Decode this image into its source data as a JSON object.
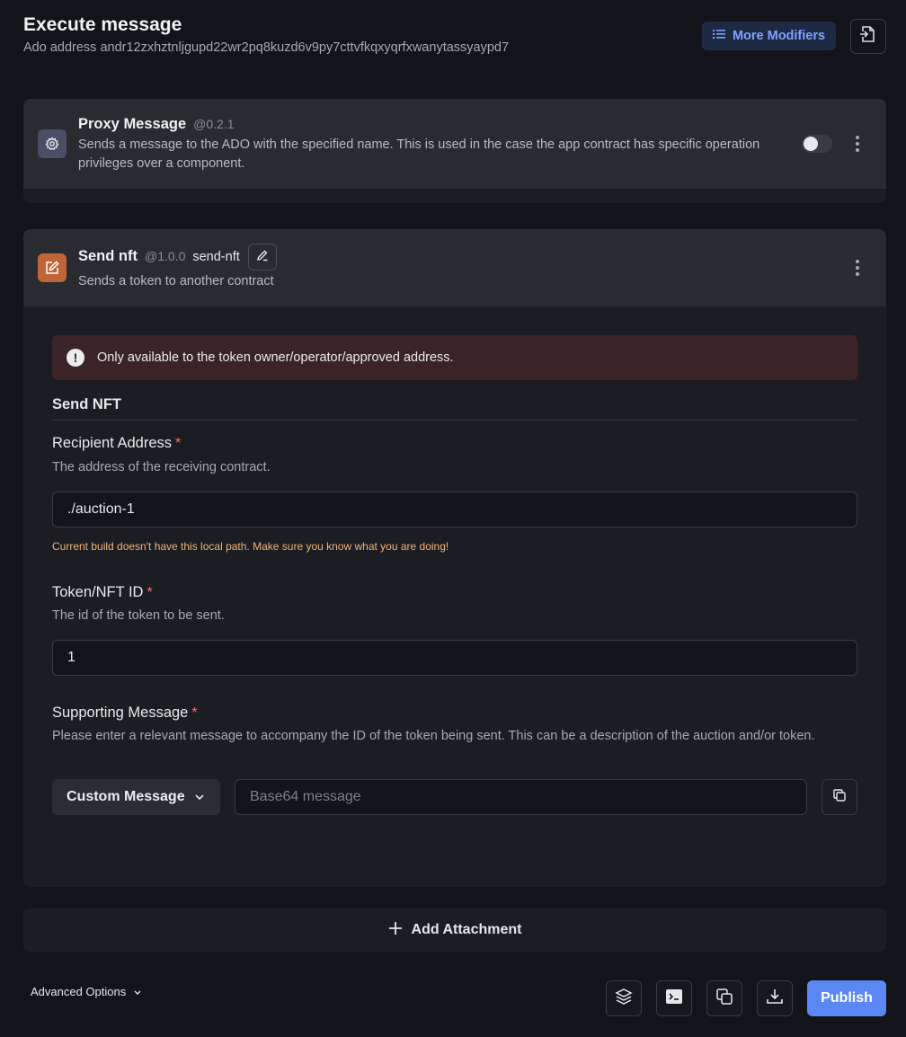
{
  "header": {
    "title": "Execute message",
    "ado_line": "Ado address andr12zxhztnljgupd22wr2pq8kuzd6v9py7cttvfkqxyqrfxwanytassyaypd7",
    "more_modifiers_label": "More Modifiers"
  },
  "proxy_card": {
    "title": "Proxy Message",
    "version": "@0.2.1",
    "description": "Sends a message to the ADO with the specified name. This is used in the case the app contract has specific operation privileges over a component.",
    "toggle_on": false
  },
  "send_card": {
    "title": "Send nft",
    "version": "@1.0.0",
    "slug": "send-nft",
    "description": "Sends a token to another contract",
    "alert": "Only available to the token owner/operator/approved address.",
    "section_title": "Send NFT",
    "recipient": {
      "label": "Recipient Address",
      "required": "*",
      "help": "The address of the receiving contract.",
      "value": "./auction-1",
      "warning": "Current build doesn't have this local path. Make sure you know what you are doing!"
    },
    "token": {
      "label": "Token/NFT ID",
      "required": "*",
      "help": "The id of the token to be sent.",
      "value": "1"
    },
    "supporting": {
      "label": "Supporting Message",
      "required": "*",
      "help": "Please enter a relevant message to accompany the ID of the token being sent. This can be a description of the auction and/or token.",
      "dropdown_value": "Custom Message",
      "placeholder": "Base64 message"
    }
  },
  "add_attachment_label": "Add Attachment",
  "footer": {
    "advanced_options_label": "Advanced Options",
    "publish_label": "Publish"
  },
  "colors": {
    "background": "#131419",
    "accent": "#5b87f5",
    "warning": "#f0b27a",
    "required": "#ff6b6b",
    "alert_bg": "#3a2428"
  }
}
